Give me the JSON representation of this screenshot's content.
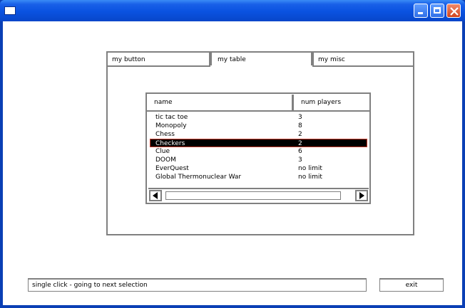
{
  "window": {
    "title": ""
  },
  "tabs": [
    {
      "label": "my button",
      "active": false
    },
    {
      "label": "my table",
      "active": true
    },
    {
      "label": "my misc",
      "active": false
    }
  ],
  "table": {
    "columns": [
      "name",
      "num players"
    ],
    "rows": [
      {
        "name": "tic tac toe",
        "players": "3"
      },
      {
        "name": "Monopoly",
        "players": "8"
      },
      {
        "name": "Chess",
        "players": "2"
      },
      {
        "name": "Checkers",
        "players": "2"
      },
      {
        "name": "Clue",
        "players": "6"
      },
      {
        "name": "DOOM",
        "players": "3"
      },
      {
        "name": "EverQuest",
        "players": "no limit"
      },
      {
        "name": "Global Thermonuclear War",
        "players": "no limit"
      }
    ],
    "selected_index": 3
  },
  "status": {
    "text": "single click - going to next selection"
  },
  "exit_button": {
    "label": "exit"
  },
  "icons": [
    "app-icon",
    "minimize-icon",
    "maximize-icon",
    "close-icon",
    "arrow-left-icon",
    "arrow-right-icon"
  ]
}
